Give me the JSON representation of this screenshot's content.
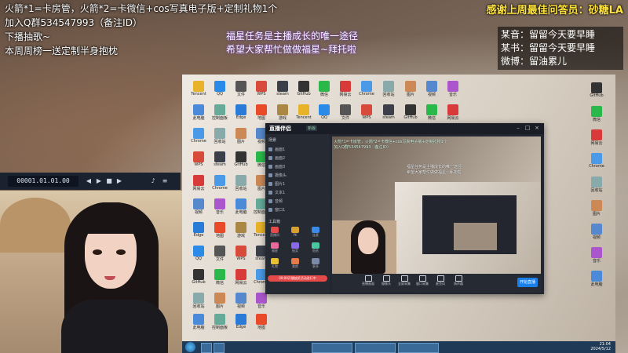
{
  "overlay": {
    "line1": "火箭*1=卡房管，火箭*2=卡微信+cos写真电子版+定制礼物1个",
    "line2": "加入Q群534547993（备注ID）",
    "line3": "下播抽歌~",
    "line4": "本周周榜一送定制半身抱枕",
    "pink1": "福星任务是主播成长的唯一途径",
    "pink2": "希望大家帮忙做做福星~拜托啦",
    "thanks_label": "感谢上周最佳问答员：",
    "thanks_name": "砂糖LA",
    "info": [
      {
        "label": "某音：",
        "value": "留留今天要早睡"
      },
      {
        "label": "某书：",
        "value": "留留今天要早睡"
      },
      {
        "label": "微博：",
        "value": "留油累儿"
      }
    ]
  },
  "player": {
    "time": "00001.01.01.00"
  },
  "desktop": {
    "icons": [
      {
        "label": "Tencent",
        "color": "#e8b32a"
      },
      {
        "label": "QQ",
        "color": "#2a8ae8"
      },
      {
        "label": "文件",
        "color": "#555"
      },
      {
        "label": "WPS",
        "color": "#d84a3a"
      },
      {
        "label": "steam",
        "color": "#3a3f4a"
      },
      {
        "label": "GitHub",
        "color": "#333"
      },
      {
        "label": "微信",
        "color": "#2ab84a"
      },
      {
        "label": "网易云",
        "color": "#d83a3a"
      },
      {
        "label": "Chrome",
        "color": "#4a9ae8"
      },
      {
        "label": "回收站",
        "color": "#8aa"
      },
      {
        "label": "图片",
        "color": "#c85"
      },
      {
        "label": "视频",
        "color": "#58c"
      },
      {
        "label": "音乐",
        "color": "#a5c"
      },
      {
        "label": "此电脑",
        "color": "#4a8ad8"
      },
      {
        "label": "控制面板",
        "color": "#6a9"
      },
      {
        "label": "Edge",
        "color": "#2a7ad8"
      },
      {
        "label": "地图",
        "color": "#e84a2a"
      },
      {
        "label": "游戏",
        "color": "#a84"
      }
    ]
  },
  "taskbar": {
    "time": "21:04",
    "date": "2024/5/12"
  },
  "app": {
    "title": "直播伴侣",
    "tab": "新版",
    "scene_header": "场景",
    "source_rows": [
      "画面1",
      "画面2",
      "画面3",
      "摄像头",
      "图片1",
      "文本1",
      "音频",
      "窗口1"
    ],
    "tools_header": "工具箱",
    "tools": [
      {
        "label": "直播间",
        "color": "#e84a4a"
      },
      {
        "label": "PK",
        "color": "#d8a030"
      },
      {
        "label": "连麦",
        "color": "#3a8ae8"
      },
      {
        "label": "福星",
        "color": "#e86a9a"
      },
      {
        "label": "抽奖",
        "color": "#8a6ae8"
      },
      {
        "label": "贴纸",
        "color": "#4ac8a0"
      },
      {
        "label": "礼物",
        "color": "#e8c030"
      },
      {
        "label": "美颜",
        "color": "#e87a4a"
      },
      {
        "label": "更多",
        "color": "#7a8aa8"
      }
    ],
    "activity_button": "09:00开播抽奖活动进行中",
    "bottom": [
      "直播画面",
      "摄像头",
      "全屏采集",
      "窗口采集",
      "麦克风",
      "扬声器"
    ],
    "live_button": "开始直播"
  }
}
